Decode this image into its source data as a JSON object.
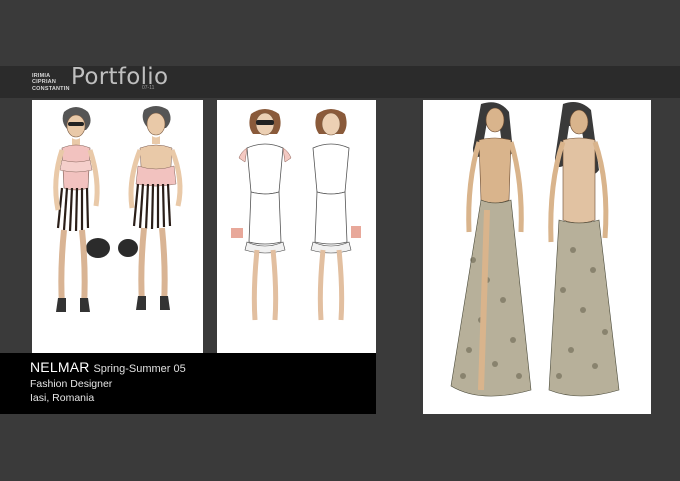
{
  "header": {
    "author_lines": [
      "IRIMIA",
      "CIPRIAN",
      "CONSTANTIN"
    ],
    "title": "Portfolio",
    "years": "07-11"
  },
  "caption": {
    "brand": "NELMAR",
    "season": "Spring-Summer 05",
    "role": "Fashion Designer",
    "location": "Iasi, Romania"
  },
  "colors": {
    "background": "#3a3a3a",
    "header_band": "#2b2b2b",
    "caption_bg": "#000000",
    "panel_bg": "#ffffff"
  }
}
